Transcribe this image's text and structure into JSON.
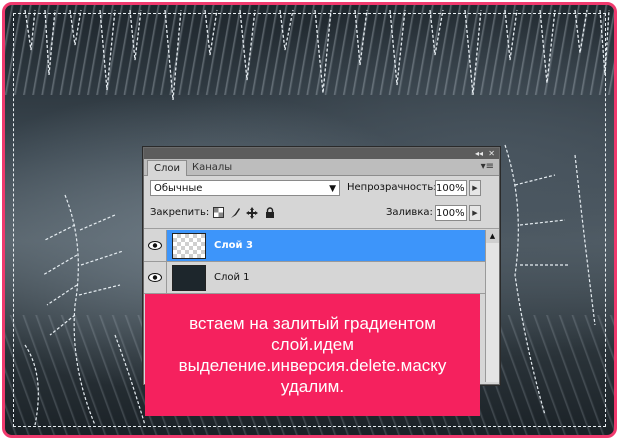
{
  "panel": {
    "tabs": [
      {
        "label": "Слои",
        "active": true
      },
      {
        "label": "Каналы",
        "active": false
      }
    ],
    "collapse_glyph": "◂◂",
    "close_glyph": "✕",
    "menu_glyph": "▾≡",
    "blend_mode": "Обычные",
    "opacity_label": "Непрозрачность:",
    "opacity_value": "100%",
    "lock_label": "Закрепить:",
    "fill_label": "Заливка:",
    "fill_value": "100%",
    "lock_icons": [
      "transparency-lock-icon",
      "brush-icon",
      "move-icon",
      "padlock-icon"
    ],
    "layers": [
      {
        "name": "Слой 3",
        "selected": true,
        "thumbnail": "transparent"
      },
      {
        "name": "Слой 1",
        "selected": false,
        "thumbnail": "dark"
      }
    ]
  },
  "note": {
    "text": "встаем на залитый градиентом слой.идем выделение.инверсия.delete.маску удалим."
  },
  "colors": {
    "frame_border": "#f03a6e",
    "note_background": "#f5215e",
    "selected_layer": "#3d95fa"
  }
}
